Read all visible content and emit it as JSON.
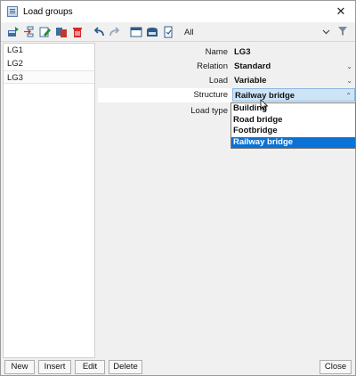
{
  "window": {
    "title": "Load groups"
  },
  "toolbar": {
    "filter_label": "All",
    "icons": [
      "new-icon",
      "insert-icon",
      "edit-icon",
      "copy-icon",
      "delete-icon",
      "undo-icon",
      "redo-icon",
      "table-icon",
      "save-icon",
      "document-icon",
      "chevron-down-icon",
      "filter-icon"
    ]
  },
  "list": {
    "items": [
      {
        "label": "LG1"
      },
      {
        "label": "LG2"
      },
      {
        "label": "LG3"
      }
    ],
    "selected": "LG3"
  },
  "properties": {
    "name": {
      "label": "Name",
      "value": "LG3"
    },
    "relation": {
      "label": "Relation",
      "value": "Standard"
    },
    "load": {
      "label": "Load",
      "value": "Variable"
    },
    "structure": {
      "label": "Structure",
      "value": "Railway bridge"
    },
    "load_type": {
      "label": "Load type",
      "value": ""
    }
  },
  "structure_dropdown": {
    "options": [
      "Building",
      "Road bridge",
      "Footbridge",
      "Railway bridge"
    ],
    "selected": "Railway bridge"
  },
  "buttons": {
    "new": "New",
    "insert": "Insert",
    "edit": "Edit",
    "delete": "Delete",
    "close": "Close"
  }
}
